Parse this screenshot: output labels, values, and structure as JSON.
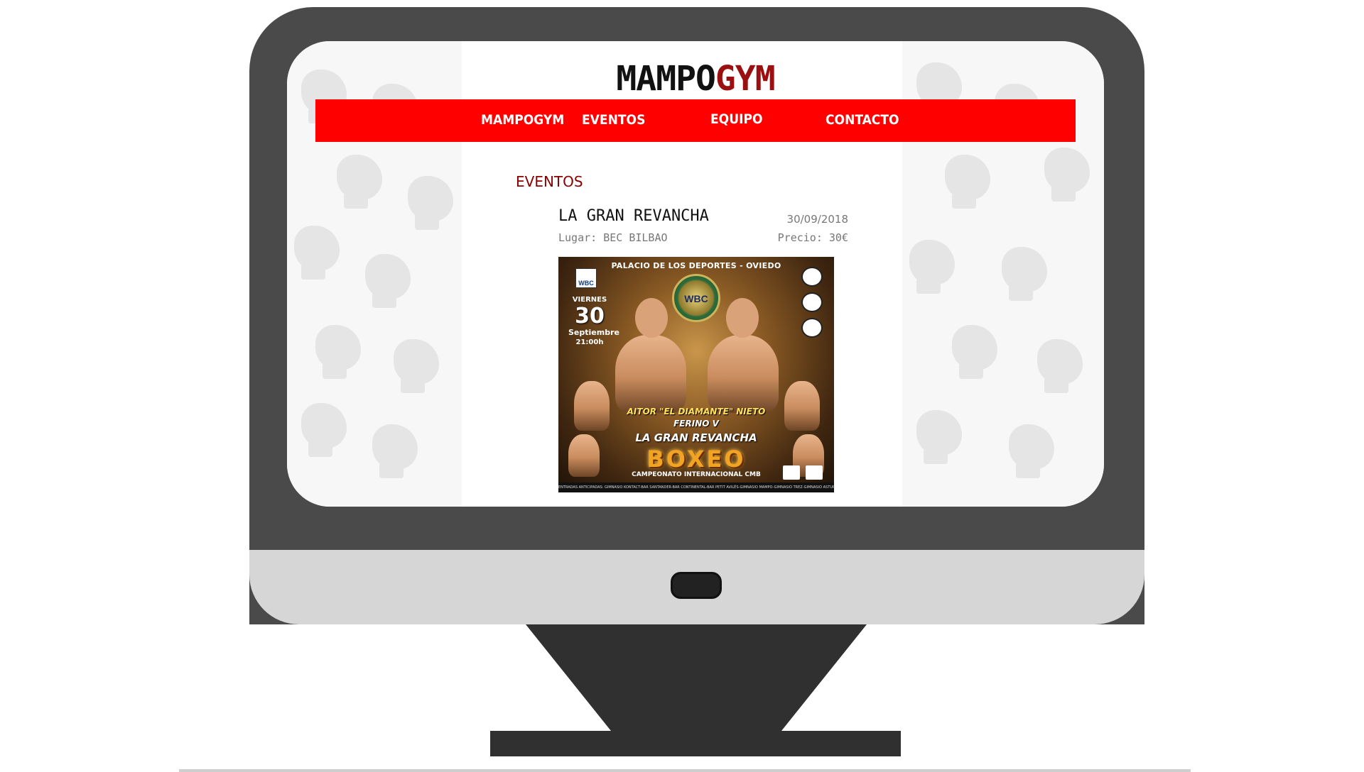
{
  "site": {
    "logo_part1": "MAMPO",
    "logo_part2": "GYM",
    "accent_color": "#ff0000",
    "logo_accent_color": "#9a1010"
  },
  "nav": {
    "items": [
      {
        "label": "MAMPOGYM"
      },
      {
        "label": "EVENTOS"
      },
      {
        "label": "EQUIPO"
      },
      {
        "label": "CONTACTO"
      }
    ]
  },
  "section": {
    "title": "EVENTOS"
  },
  "event": {
    "title": "LA GRAN REVANCHA",
    "date": "30/09/2018",
    "place": "Lugar: BEC BILBAO",
    "price": "Precio: 30€"
  },
  "poster": {
    "venue": "PALACIO DE LOS DEPORTES - OVIEDO",
    "badge": "WBC",
    "belt": "WBC",
    "day": "VIERNES",
    "day_number": "30",
    "month": "Septiembre",
    "time": "21:00h",
    "fighter_name": "AITOR \"EL DIAMANTE\" NIETO",
    "versus": "FERINO V",
    "headline": "LA GRAN REVANCHA",
    "sport": "BOXEO",
    "championship": "CAMPEONATO INTERNACIONAL CMB",
    "footer": "ENTRADAS ANTICIPADAS: GIMNASIO KONTACT-BAR SANTANDER-BAR CONTINENTAL-BAR PETIT AVILÉS-GIMNASIO MAMPO-GIMNASIO TREZ-GIMNASIO ASTURBOX"
  }
}
